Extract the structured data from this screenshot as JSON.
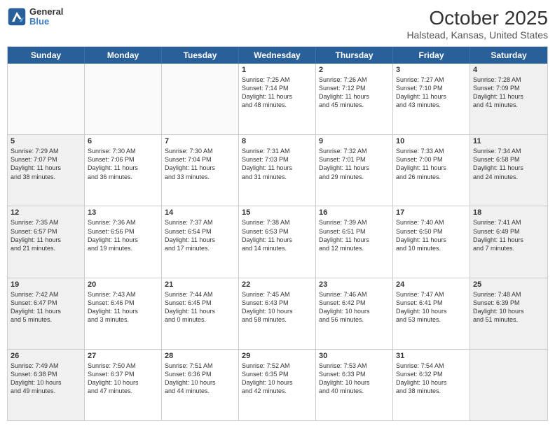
{
  "logo": {
    "line1": "General",
    "line2": "Blue"
  },
  "title": "October 2025",
  "subtitle": "Halstead, Kansas, United States",
  "headers": [
    "Sunday",
    "Monday",
    "Tuesday",
    "Wednesday",
    "Thursday",
    "Friday",
    "Saturday"
  ],
  "rows": [
    [
      {
        "day": "",
        "text": "",
        "empty": true
      },
      {
        "day": "",
        "text": "",
        "empty": true
      },
      {
        "day": "",
        "text": "",
        "empty": true
      },
      {
        "day": "1",
        "text": "Sunrise: 7:25 AM\nSunset: 7:14 PM\nDaylight: 11 hours\nand 48 minutes.",
        "empty": false
      },
      {
        "day": "2",
        "text": "Sunrise: 7:26 AM\nSunset: 7:12 PM\nDaylight: 11 hours\nand 45 minutes.",
        "empty": false
      },
      {
        "day": "3",
        "text": "Sunrise: 7:27 AM\nSunset: 7:10 PM\nDaylight: 11 hours\nand 43 minutes.",
        "empty": false
      },
      {
        "day": "4",
        "text": "Sunrise: 7:28 AM\nSunset: 7:09 PM\nDaylight: 11 hours\nand 41 minutes.",
        "empty": false,
        "shaded": true
      }
    ],
    [
      {
        "day": "5",
        "text": "Sunrise: 7:29 AM\nSunset: 7:07 PM\nDaylight: 11 hours\nand 38 minutes.",
        "empty": false,
        "shaded": true
      },
      {
        "day": "6",
        "text": "Sunrise: 7:30 AM\nSunset: 7:06 PM\nDaylight: 11 hours\nand 36 minutes.",
        "empty": false
      },
      {
        "day": "7",
        "text": "Sunrise: 7:30 AM\nSunset: 7:04 PM\nDaylight: 11 hours\nand 33 minutes.",
        "empty": false
      },
      {
        "day": "8",
        "text": "Sunrise: 7:31 AM\nSunset: 7:03 PM\nDaylight: 11 hours\nand 31 minutes.",
        "empty": false
      },
      {
        "day": "9",
        "text": "Sunrise: 7:32 AM\nSunset: 7:01 PM\nDaylight: 11 hours\nand 29 minutes.",
        "empty": false
      },
      {
        "day": "10",
        "text": "Sunrise: 7:33 AM\nSunset: 7:00 PM\nDaylight: 11 hours\nand 26 minutes.",
        "empty": false
      },
      {
        "day": "11",
        "text": "Sunrise: 7:34 AM\nSunset: 6:58 PM\nDaylight: 11 hours\nand 24 minutes.",
        "empty": false,
        "shaded": true
      }
    ],
    [
      {
        "day": "12",
        "text": "Sunrise: 7:35 AM\nSunset: 6:57 PM\nDaylight: 11 hours\nand 21 minutes.",
        "empty": false,
        "shaded": true
      },
      {
        "day": "13",
        "text": "Sunrise: 7:36 AM\nSunset: 6:56 PM\nDaylight: 11 hours\nand 19 minutes.",
        "empty": false
      },
      {
        "day": "14",
        "text": "Sunrise: 7:37 AM\nSunset: 6:54 PM\nDaylight: 11 hours\nand 17 minutes.",
        "empty": false
      },
      {
        "day": "15",
        "text": "Sunrise: 7:38 AM\nSunset: 6:53 PM\nDaylight: 11 hours\nand 14 minutes.",
        "empty": false
      },
      {
        "day": "16",
        "text": "Sunrise: 7:39 AM\nSunset: 6:51 PM\nDaylight: 11 hours\nand 12 minutes.",
        "empty": false
      },
      {
        "day": "17",
        "text": "Sunrise: 7:40 AM\nSunset: 6:50 PM\nDaylight: 11 hours\nand 10 minutes.",
        "empty": false
      },
      {
        "day": "18",
        "text": "Sunrise: 7:41 AM\nSunset: 6:49 PM\nDaylight: 11 hours\nand 7 minutes.",
        "empty": false,
        "shaded": true
      }
    ],
    [
      {
        "day": "19",
        "text": "Sunrise: 7:42 AM\nSunset: 6:47 PM\nDaylight: 11 hours\nand 5 minutes.",
        "empty": false,
        "shaded": true
      },
      {
        "day": "20",
        "text": "Sunrise: 7:43 AM\nSunset: 6:46 PM\nDaylight: 11 hours\nand 3 minutes.",
        "empty": false
      },
      {
        "day": "21",
        "text": "Sunrise: 7:44 AM\nSunset: 6:45 PM\nDaylight: 11 hours\nand 0 minutes.",
        "empty": false
      },
      {
        "day": "22",
        "text": "Sunrise: 7:45 AM\nSunset: 6:43 PM\nDaylight: 10 hours\nand 58 minutes.",
        "empty": false
      },
      {
        "day": "23",
        "text": "Sunrise: 7:46 AM\nSunset: 6:42 PM\nDaylight: 10 hours\nand 56 minutes.",
        "empty": false
      },
      {
        "day": "24",
        "text": "Sunrise: 7:47 AM\nSunset: 6:41 PM\nDaylight: 10 hours\nand 53 minutes.",
        "empty": false
      },
      {
        "day": "25",
        "text": "Sunrise: 7:48 AM\nSunset: 6:39 PM\nDaylight: 10 hours\nand 51 minutes.",
        "empty": false,
        "shaded": true
      }
    ],
    [
      {
        "day": "26",
        "text": "Sunrise: 7:49 AM\nSunset: 6:38 PM\nDaylight: 10 hours\nand 49 minutes.",
        "empty": false,
        "shaded": true
      },
      {
        "day": "27",
        "text": "Sunrise: 7:50 AM\nSunset: 6:37 PM\nDaylight: 10 hours\nand 47 minutes.",
        "empty": false
      },
      {
        "day": "28",
        "text": "Sunrise: 7:51 AM\nSunset: 6:36 PM\nDaylight: 10 hours\nand 44 minutes.",
        "empty": false
      },
      {
        "day": "29",
        "text": "Sunrise: 7:52 AM\nSunset: 6:35 PM\nDaylight: 10 hours\nand 42 minutes.",
        "empty": false
      },
      {
        "day": "30",
        "text": "Sunrise: 7:53 AM\nSunset: 6:33 PM\nDaylight: 10 hours\nand 40 minutes.",
        "empty": false
      },
      {
        "day": "31",
        "text": "Sunrise: 7:54 AM\nSunset: 6:32 PM\nDaylight: 10 hours\nand 38 minutes.",
        "empty": false
      },
      {
        "day": "",
        "text": "",
        "empty": true,
        "shaded": true
      }
    ]
  ]
}
